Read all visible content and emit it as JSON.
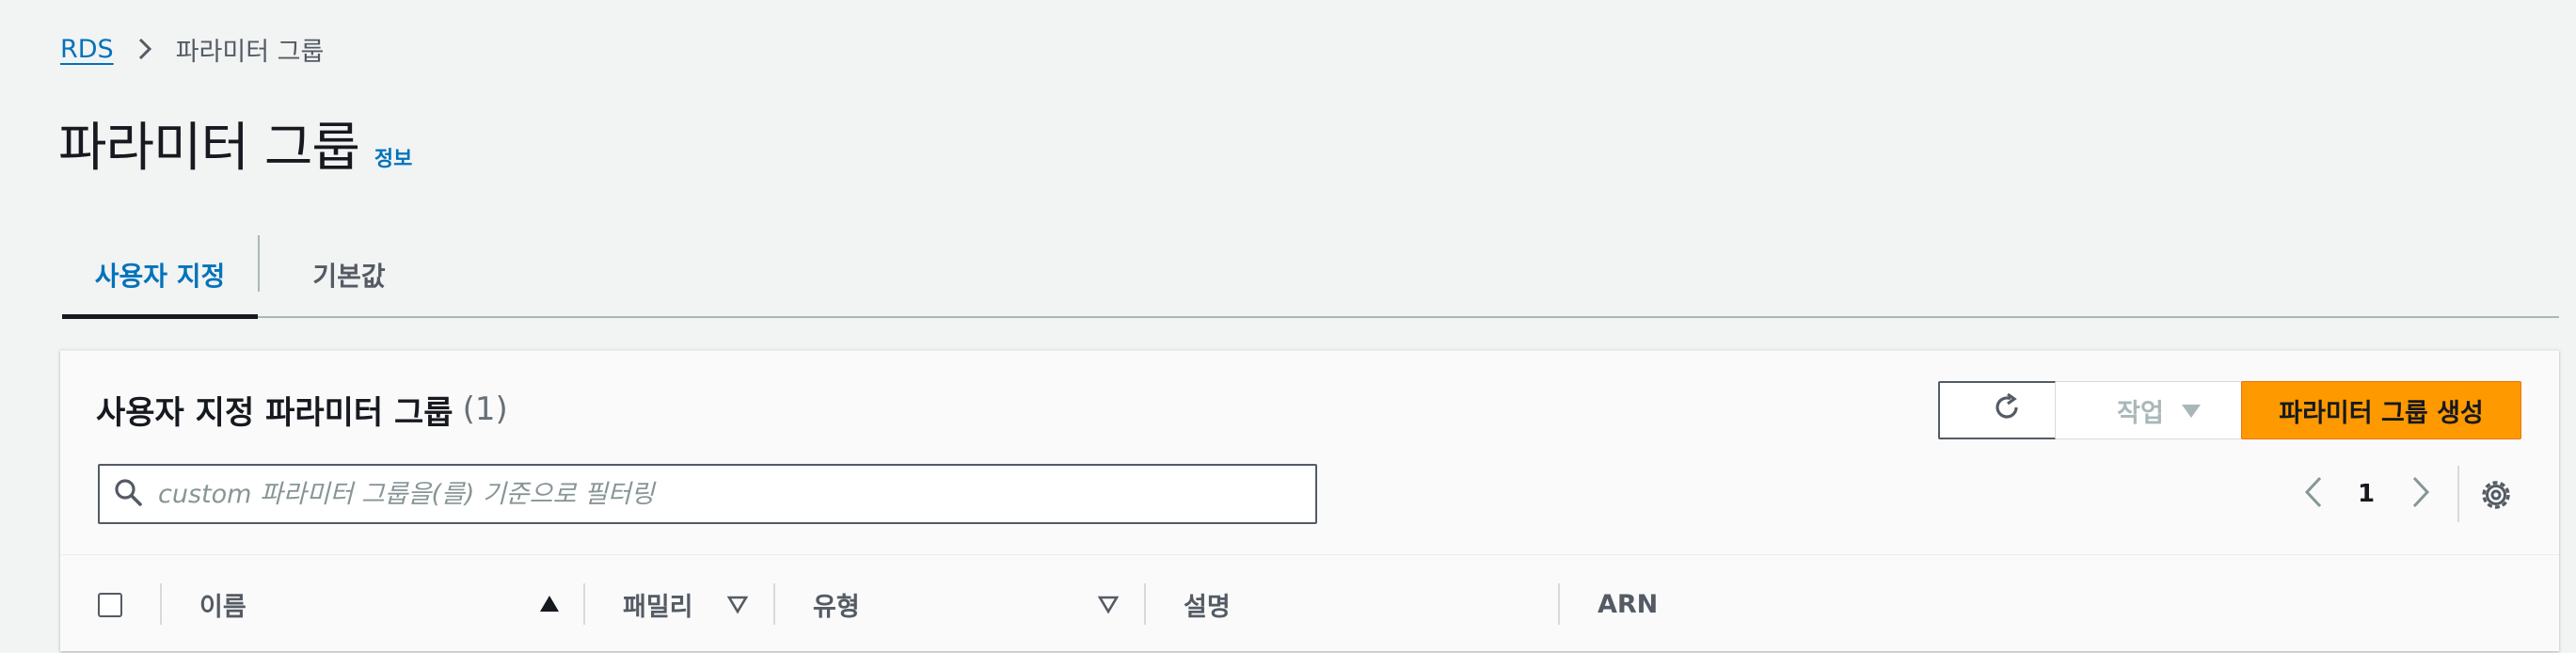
{
  "breadcrumb": {
    "root": "RDS",
    "current": "파라미터 그룹"
  },
  "page": {
    "title": "파라미터 그룹",
    "info_link": "정보"
  },
  "tabs": [
    {
      "label": "사용자 지정",
      "active": true
    },
    {
      "label": "기본값",
      "active": false
    }
  ],
  "panel": {
    "title": "사용자 지정 파라미터 그룹",
    "count": "(1)",
    "actions_label": "작업",
    "create_label": "파라미터 그룹 생성",
    "search_placeholder": "custom 파라미터 그룹을(를) 기준으로 필터링",
    "page_number": "1"
  },
  "table": {
    "columns": [
      "이름",
      "패밀리",
      "유형",
      "설명",
      "ARN"
    ]
  },
  "icons": {
    "refresh": "refresh-icon",
    "dropdown": "caret-down-icon",
    "search": "search-icon",
    "settings": "gear-icon"
  },
  "colors": {
    "link": "#0073bb",
    "primary_button": "#ff9900",
    "text": "#16191f",
    "muted": "#545b64"
  }
}
